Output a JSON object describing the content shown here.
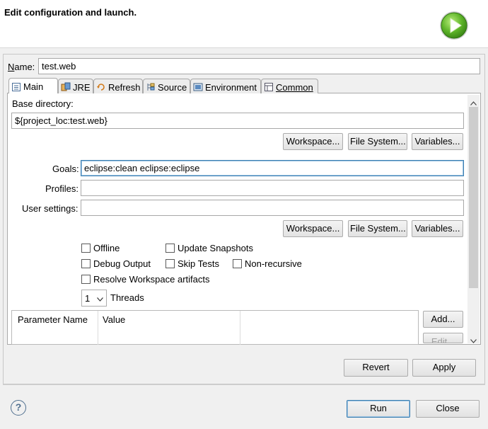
{
  "banner": {
    "title": "Edit configuration and launch.",
    "logo_icon": "run-launch-icon"
  },
  "name": {
    "label": "Name:",
    "value": "test.web"
  },
  "tabs": [
    {
      "label": "Main",
      "icon": "main-tab-icon"
    },
    {
      "label": "JRE",
      "icon": "jre-icon"
    },
    {
      "label": "Refresh",
      "icon": "refresh-icon"
    },
    {
      "label": "Source",
      "icon": "source-icon"
    },
    {
      "label": "Environment",
      "icon": "environment-icon"
    },
    {
      "label": "Common",
      "icon": "common-icon"
    }
  ],
  "main": {
    "base_dir_label": "Base directory:",
    "base_dir_value": "${project_loc:test.web}",
    "workspace_btn": "Workspace...",
    "filesystem_btn": "File System...",
    "variables_btn": "Variables...",
    "goals_label": "Goals:",
    "goals_value": "eclipse:clean eclipse:eclipse",
    "profiles_label": "Profiles:",
    "profiles_value": "",
    "user_settings_label": "User settings:",
    "user_settings_value": "",
    "checkboxes": {
      "offline": "Offline",
      "update_snapshots": "Update Snapshots",
      "debug_output": "Debug Output",
      "skip_tests": "Skip Tests",
      "non_recursive": "Non-recursive",
      "resolve_workspace": "Resolve Workspace artifacts"
    },
    "threads_value": "1",
    "threads_label": "Threads",
    "table": {
      "col_param": "Parameter Name",
      "col_value": "Value"
    },
    "add_btn": "Add...",
    "edit_btn": "Edit..."
  },
  "footer": {
    "revert": "Revert",
    "apply": "Apply",
    "run": "Run",
    "close": "Close",
    "help_icon": "help-icon"
  }
}
